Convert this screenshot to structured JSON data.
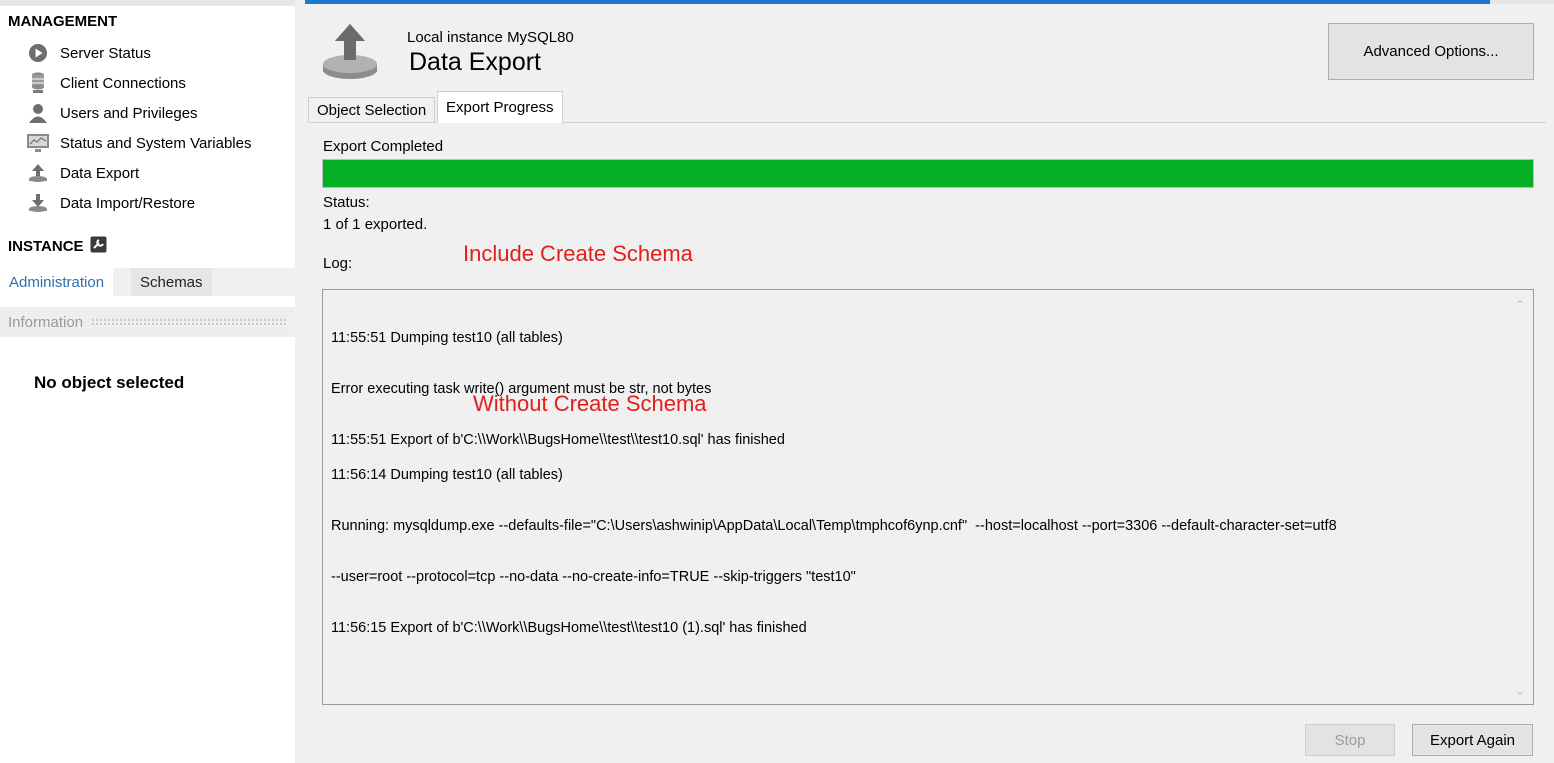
{
  "sidebar": {
    "management_heading": "MANAGEMENT",
    "items": [
      {
        "label": "Server Status",
        "icon": "play-circle-icon"
      },
      {
        "label": "Client Connections",
        "icon": "database-stack-icon"
      },
      {
        "label": "Users and Privileges",
        "icon": "user-icon"
      },
      {
        "label": "Status and System Variables",
        "icon": "monitor-icon"
      },
      {
        "label": "Data Export",
        "icon": "export-upload-icon"
      },
      {
        "label": "Data Import/Restore",
        "icon": "import-download-icon"
      }
    ],
    "instance_heading": "INSTANCE",
    "tabs": {
      "administration": "Administration",
      "schemas": "Schemas"
    },
    "information_label": "Information",
    "no_object": "No object selected"
  },
  "header": {
    "subtitle": "Local instance MySQL80",
    "title": "Data Export",
    "advanced_options": "Advanced Options..."
  },
  "tabs": {
    "object_selection": "Object Selection",
    "export_progress": "Export Progress"
  },
  "progress": {
    "label": "Export Completed",
    "percent": 100,
    "color": "#06b025",
    "status_label": "Status:",
    "status_value": "1 of 1 exported.",
    "log_label": "Log:"
  },
  "annotations": {
    "include": "Include Create Schema",
    "without": "Without Create Schema",
    "color": "#e0201c"
  },
  "log": {
    "block1": [
      "11:55:51 Dumping test10 (all tables)",
      "Error executing task write() argument must be str, not bytes",
      "11:55:51 Export of b'C:\\\\Work\\\\BugsHome\\\\test\\\\test10.sql' has finished"
    ],
    "block2": [
      "11:56:14 Dumping test10 (all tables)",
      "Running: mysqldump.exe --defaults-file=\"C:\\Users\\ashwinip\\AppData\\Local\\Temp\\tmphcof6ynp.cnf\"  --host=localhost --port=3306 --default-character-set=utf8",
      "--user=root --protocol=tcp --no-data --no-create-info=TRUE --skip-triggers \"test10\"",
      "11:56:15 Export of b'C:\\\\Work\\\\BugsHome\\\\test\\\\test10 (1).sql' has finished"
    ]
  },
  "buttons": {
    "stop": "Stop",
    "export_again": "Export Again"
  }
}
